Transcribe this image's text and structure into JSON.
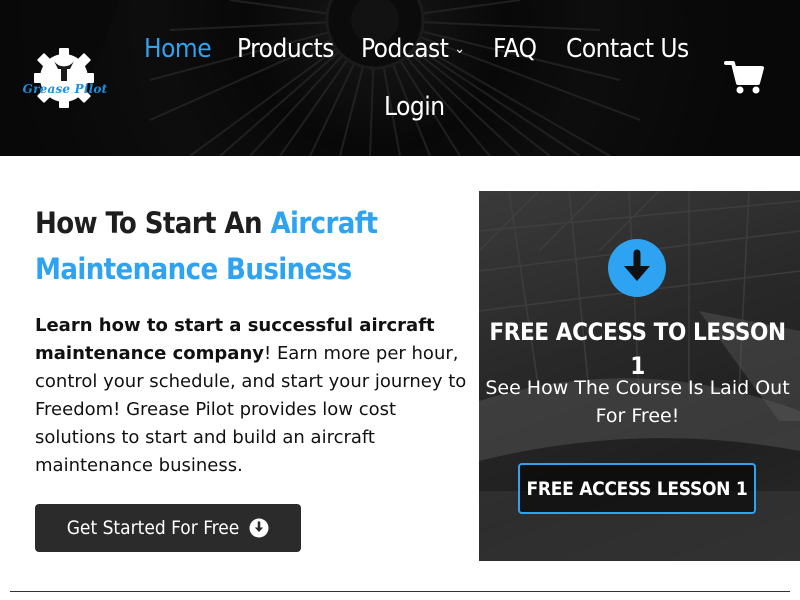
{
  "brand": {
    "logo_text": "Grease Pilot",
    "accent_color": "#2ea3f2",
    "logo_icon": "gear-wrench-icon"
  },
  "nav": {
    "items": [
      {
        "label": "Home",
        "active": true
      },
      {
        "label": "Products",
        "active": false
      },
      {
        "label": "Podcast",
        "active": false,
        "has_dropdown": true
      },
      {
        "label": "FAQ",
        "active": false
      },
      {
        "label": "Contact Us",
        "active": false
      },
      {
        "label": "Login",
        "active": false
      }
    ],
    "cart_icon": "shopping-cart-icon"
  },
  "hero": {
    "title_part1": "How To Start An ",
    "title_accent": "Aircraft Maintenance Business",
    "intro_bold": "Learn how to start a successful aircraft maintenance company",
    "intro_rest": "! Earn more per hour, control your schedule, and start your journey to Freedom! Grease Pilot provides low cost solutions to start and build an aircraft maintenance business.",
    "cta_label": "Get Started For Free",
    "cta_icon": "arrow-circle-down-icon"
  },
  "panel": {
    "icon": "arrow-circle-down-icon",
    "title": "FREE ACCESS TO LESSON 1",
    "subtitle": "See How The Course Is Laid Out For Free!",
    "button_label": "FREE ACCESS LESSON 1"
  }
}
